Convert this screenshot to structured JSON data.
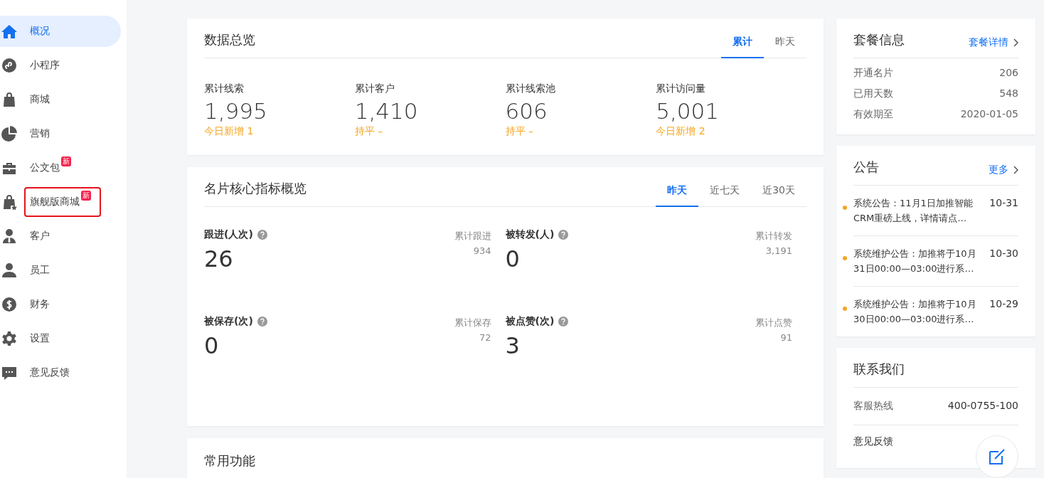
{
  "sidebar": {
    "items": [
      {
        "label": "概况",
        "selected": true,
        "highlighted": false
      },
      {
        "label": "小程序",
        "selected": false,
        "highlighted": false
      },
      {
        "label": "商城",
        "selected": false,
        "highlighted": false
      },
      {
        "label": "营销",
        "selected": false,
        "highlighted": false
      },
      {
        "label": "公文包",
        "selected": false,
        "highlighted": false,
        "badge": "新"
      },
      {
        "label": "旗舰版商城",
        "selected": false,
        "highlighted": true,
        "badge": "新"
      },
      {
        "label": "客户",
        "selected": false,
        "highlighted": false
      },
      {
        "label": "员工",
        "selected": false,
        "highlighted": false
      },
      {
        "label": "财务",
        "selected": false,
        "highlighted": false
      },
      {
        "label": "设置",
        "selected": false,
        "highlighted": false
      },
      {
        "label": "意见反馈",
        "selected": false,
        "highlighted": false
      }
    ]
  },
  "overview": {
    "title": "数据总览",
    "tabs": [
      {
        "label": "累计",
        "selected": true
      },
      {
        "label": "昨天",
        "selected": false
      }
    ],
    "stats": [
      {
        "label": "累计线索",
        "value": "1,995",
        "change": "今日新增 1"
      },
      {
        "label": "累计客户",
        "value": "1,410",
        "change": "持平 –"
      },
      {
        "label": "累计线索池",
        "value": "606",
        "change": "持平 –"
      },
      {
        "label": "累计访问量",
        "value": "5,001",
        "change": "今日新增 2"
      }
    ]
  },
  "metrics": {
    "title": "名片核心指标概览",
    "tabs": [
      {
        "label": "昨天",
        "selected": true
      },
      {
        "label": "近七天",
        "selected": false
      },
      {
        "label": "近30天",
        "selected": false
      }
    ],
    "items": [
      {
        "label": "跟进(人次)",
        "value": "26",
        "total_label": "累计跟进",
        "total": "934"
      },
      {
        "label": "被转发(人)",
        "value": "0",
        "total_label": "累计转发",
        "total": "3,191"
      },
      {
        "label": "被保存(次)",
        "value": "0",
        "total_label": "累计保存",
        "total": "72"
      },
      {
        "label": "被点赞(次)",
        "value": "3",
        "total_label": "累计点赞",
        "total": "91"
      }
    ]
  },
  "common": {
    "title": "常用功能"
  },
  "plan": {
    "title": "套餐信息",
    "link": "套餐详情",
    "rows": [
      {
        "label": "开通名片",
        "value": "206"
      },
      {
        "label": "已用天数",
        "value": "548"
      },
      {
        "label": "有效期至",
        "value": "2020-01-05"
      }
    ]
  },
  "notices": {
    "title": "公告",
    "link": "更多",
    "items": [
      {
        "text": "系统公告：11月1日加推智能CRM重磅上线，详情请点…",
        "date": "10-31"
      },
      {
        "text": "系统维护公告：加推将于10月31日00:00—03:00进行系…",
        "date": "10-30"
      },
      {
        "text": "系统维护公告：加推将于10月30日00:00—03:00进行系…",
        "date": "10-29"
      }
    ]
  },
  "contact": {
    "title": "联系我们",
    "hotline_label": "客服热线",
    "hotline": "400-0755-100",
    "feedback_label": "意见反馈"
  }
}
